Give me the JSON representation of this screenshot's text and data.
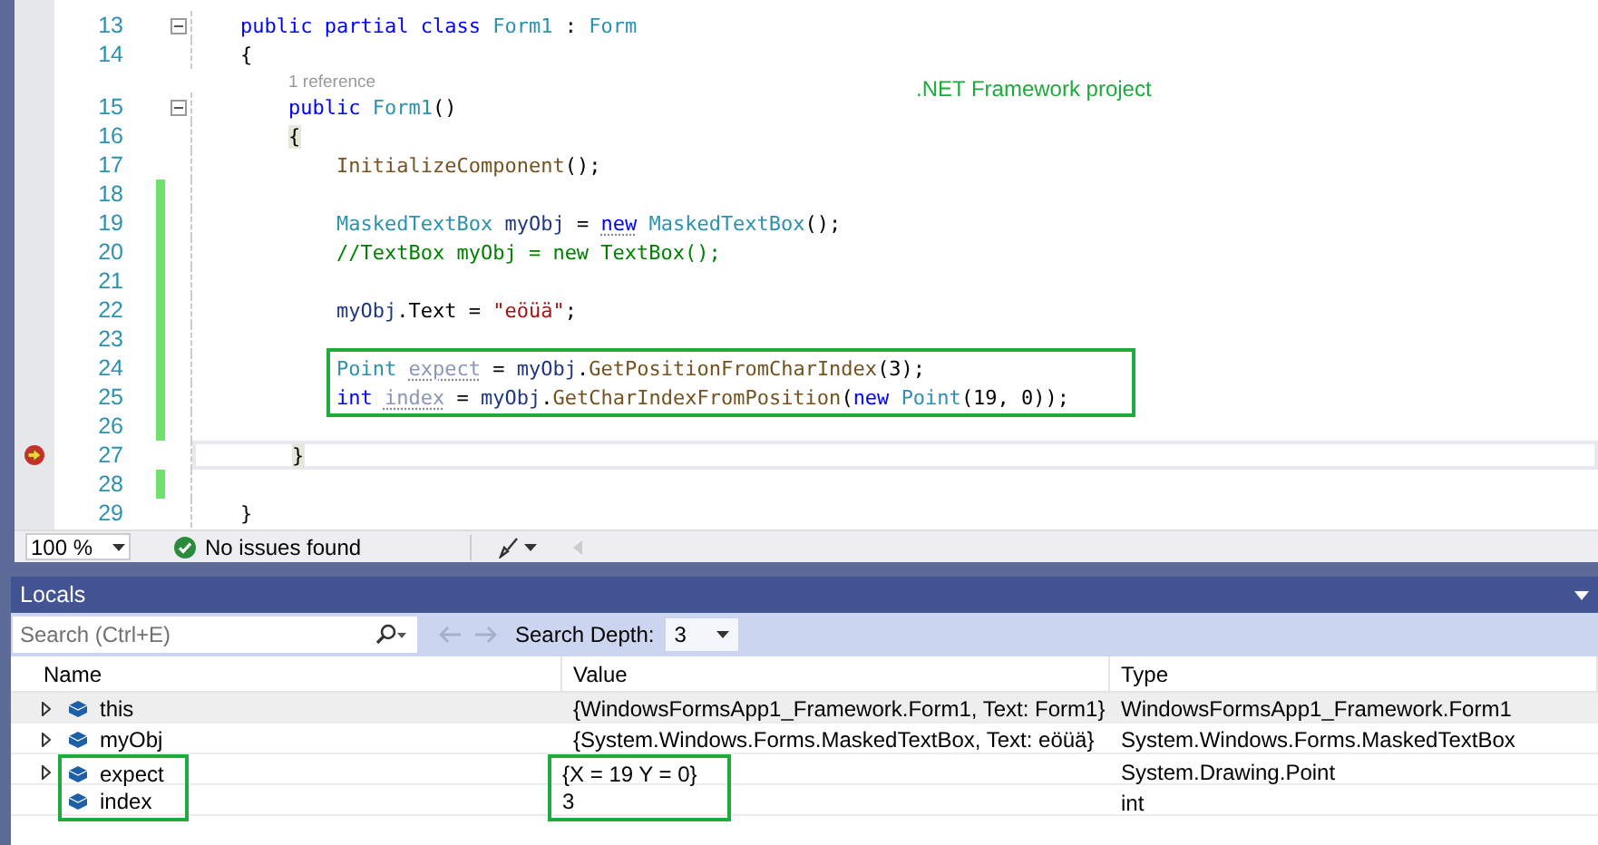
{
  "editor": {
    "annotation": ".NET Framework project",
    "lines": [
      {
        "kind": "code",
        "number": "13",
        "foldable": true,
        "changed": false,
        "current": false,
        "breakpoint": false,
        "highlighted": false,
        "tokens": [
          {
            "kind": "keyword",
            "text": "    public "
          },
          {
            "kind": "keyword",
            "text": "partial "
          },
          {
            "kind": "keyword",
            "text": "class "
          },
          {
            "kind": "type",
            "text": "Form1"
          },
          {
            "kind": "plain",
            "text": " : "
          },
          {
            "kind": "type",
            "text": "Form"
          }
        ]
      },
      {
        "kind": "code",
        "number": "14",
        "foldable": false,
        "changed": false,
        "current": false,
        "breakpoint": false,
        "highlighted": false,
        "tokens": [
          {
            "kind": "plain",
            "text": "    {"
          }
        ]
      },
      {
        "kind": "codelens",
        "text": "        1 reference"
      },
      {
        "kind": "code",
        "number": "15",
        "foldable": true,
        "changed": false,
        "current": false,
        "breakpoint": false,
        "highlighted": false,
        "tokens": [
          {
            "kind": "keyword",
            "text": "        public "
          },
          {
            "kind": "type",
            "text": "Form1"
          },
          {
            "kind": "plain",
            "text": "()"
          }
        ]
      },
      {
        "kind": "code",
        "number": "16",
        "foldable": false,
        "changed": false,
        "current": false,
        "breakpoint": false,
        "highlighted": false,
        "tokens": [
          {
            "kind": "brace_match",
            "text": "        {"
          }
        ]
      },
      {
        "kind": "code",
        "number": "17",
        "foldable": false,
        "changed": false,
        "current": false,
        "breakpoint": false,
        "highlighted": false,
        "tokens": [
          {
            "kind": "method",
            "text": "            InitializeComponent"
          },
          {
            "kind": "plain",
            "text": "();"
          }
        ]
      },
      {
        "kind": "code",
        "number": "18",
        "foldable": false,
        "changed": true,
        "current": false,
        "breakpoint": false,
        "highlighted": false
      },
      {
        "kind": "code",
        "number": "19",
        "foldable": false,
        "changed": true,
        "current": false,
        "breakpoint": false,
        "highlighted": false,
        "tokens": [
          {
            "kind": "type",
            "text": "            MaskedTextBox "
          },
          {
            "kind": "variable",
            "text": "myObj"
          },
          {
            "kind": "plain",
            "text": " = "
          },
          {
            "kind": "keyword_hint",
            "text": "new"
          },
          {
            "kind": "type",
            "text": " MaskedTextBox"
          },
          {
            "kind": "plain",
            "text": "();"
          }
        ]
      },
      {
        "kind": "code",
        "number": "20",
        "foldable": false,
        "changed": true,
        "current": false,
        "breakpoint": false,
        "highlighted": false,
        "tokens": [
          {
            "kind": "comment",
            "text": "            //TextBox myObj = new TextBox();"
          }
        ]
      },
      {
        "kind": "code",
        "number": "21",
        "foldable": false,
        "changed": true,
        "current": false,
        "breakpoint": false,
        "highlighted": false
      },
      {
        "kind": "code",
        "number": "22",
        "foldable": false,
        "changed": true,
        "current": false,
        "breakpoint": false,
        "highlighted": false,
        "tokens": [
          {
            "kind": "variable",
            "text": "            myObj"
          },
          {
            "kind": "plain",
            "text": ".Text = "
          },
          {
            "kind": "string",
            "text": "\"eöüä\""
          },
          {
            "kind": "plain",
            "text": ";"
          }
        ]
      },
      {
        "kind": "code",
        "number": "23",
        "foldable": false,
        "changed": true,
        "current": false,
        "breakpoint": false,
        "highlighted": false
      },
      {
        "kind": "code",
        "number": "24",
        "foldable": false,
        "changed": true,
        "current": false,
        "breakpoint": false,
        "highlighted": true,
        "tokens": [
          {
            "kind": "type",
            "text": "            Point "
          },
          {
            "kind": "unused",
            "text": "expect"
          },
          {
            "kind": "plain",
            "text": " = "
          },
          {
            "kind": "variable",
            "text": "myObj"
          },
          {
            "kind": "plain",
            "text": "."
          },
          {
            "kind": "method",
            "text": "GetPositionFromCharIndex"
          },
          {
            "kind": "plain",
            "text": "(3);"
          }
        ]
      },
      {
        "kind": "code",
        "number": "25",
        "foldable": false,
        "changed": true,
        "current": false,
        "breakpoint": false,
        "highlighted": true,
        "tokens": [
          {
            "kind": "keyword",
            "text": "            int "
          },
          {
            "kind": "unused",
            "text": "index"
          },
          {
            "kind": "plain",
            "text": " = "
          },
          {
            "kind": "variable",
            "text": "myObj"
          },
          {
            "kind": "plain",
            "text": "."
          },
          {
            "kind": "method",
            "text": "GetCharIndexFromPosition"
          },
          {
            "kind": "plain",
            "text": "("
          },
          {
            "kind": "keyword",
            "text": "new "
          },
          {
            "kind": "type",
            "text": "Point"
          },
          {
            "kind": "plain",
            "text": "(19, 0));"
          }
        ]
      },
      {
        "kind": "code",
        "number": "26",
        "foldable": false,
        "changed": true,
        "current": false,
        "breakpoint": false,
        "highlighted": false
      },
      {
        "kind": "code",
        "number": "27",
        "foldable": false,
        "changed": false,
        "current": true,
        "breakpoint": true,
        "highlighted": false,
        "tokens": [
          {
            "kind": "brace_match",
            "text": "        }"
          }
        ]
      },
      {
        "kind": "code",
        "number": "28",
        "foldable": false,
        "changed": true,
        "current": false,
        "breakpoint": false,
        "highlighted": false
      },
      {
        "kind": "code",
        "number": "29",
        "foldable": false,
        "changed": false,
        "current": false,
        "breakpoint": false,
        "highlighted": false,
        "tokens": [
          {
            "kind": "plain",
            "text": "    }"
          }
        ]
      }
    ]
  },
  "status_bar": {
    "zoom": "100 %",
    "issues": "No issues found"
  },
  "locals": {
    "title": "Locals",
    "search": {
      "placeholder": "Search (Ctrl+E)"
    },
    "search_depth_label": "Search Depth:",
    "search_depth": "3",
    "columns": [
      "Name",
      "Value",
      "Type"
    ],
    "rows": [
      {
        "name": "this",
        "value": "{WindowsFormsApp1_Framework.Form1, Text: Form1}",
        "type": "WindowsFormsApp1_Framework.Form1",
        "expandable": true,
        "selected": true,
        "highlighted": false
      },
      {
        "name": "myObj",
        "value": "{System.Windows.Forms.MaskedTextBox, Text: eöüä}",
        "type": "System.Windows.Forms.MaskedTextBox",
        "expandable": true,
        "selected": false,
        "highlighted": false
      },
      {
        "name": "expect",
        "value": "{X = 19 Y = 0}",
        "type": "System.Drawing.Point",
        "expandable": true,
        "selected": false,
        "highlighted": true
      },
      {
        "name": "index",
        "value": "3",
        "type": "int",
        "expandable": false,
        "selected": false,
        "highlighted": true
      }
    ]
  }
}
